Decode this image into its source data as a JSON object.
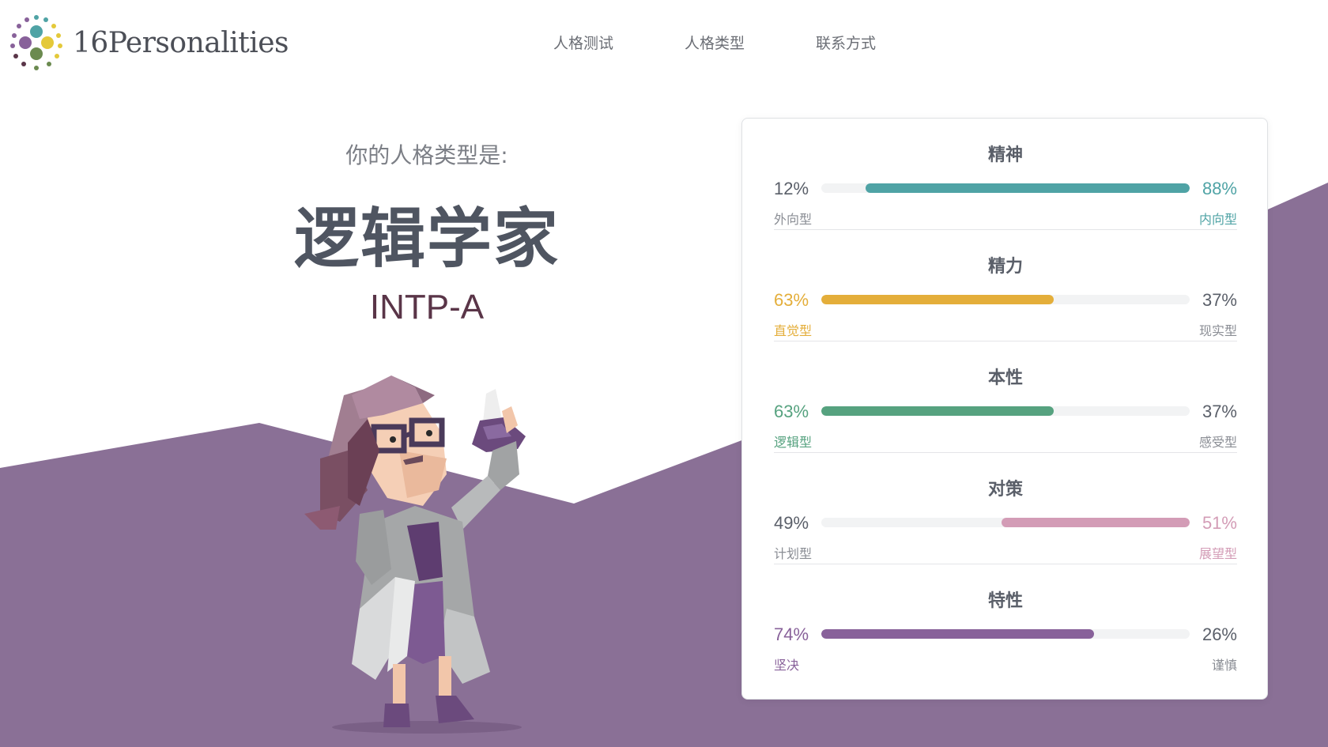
{
  "brand": {
    "name": "16Personalities"
  },
  "nav": {
    "items": [
      "人格测试",
      "人格类型",
      "联系方式"
    ]
  },
  "hero": {
    "intro": "你的人格类型是:",
    "type_name": "逻辑学家",
    "type_code": "INTP-A"
  },
  "colors": {
    "purple_bg": "#8a7096",
    "teal": "#4fa3a5",
    "yellow": "#e4ae3a",
    "green": "#56a27f",
    "pink": "#d39cb6",
    "violet": "#88619a"
  },
  "traits": [
    {
      "title": "精神",
      "left_pct": "12%",
      "right_pct": "88%",
      "left_label": "外向型",
      "right_label": "内向型",
      "dominant": "right",
      "fill": 0.88,
      "color": "#4fa3a5"
    },
    {
      "title": "精力",
      "left_pct": "63%",
      "right_pct": "37%",
      "left_label": "直觉型",
      "right_label": "现实型",
      "dominant": "left",
      "fill": 0.63,
      "color": "#e4ae3a"
    },
    {
      "title": "本性",
      "left_pct": "63%",
      "right_pct": "37%",
      "left_label": "逻辑型",
      "right_label": "感受型",
      "dominant": "left",
      "fill": 0.63,
      "color": "#56a27f"
    },
    {
      "title": "对策",
      "left_pct": "49%",
      "right_pct": "51%",
      "left_label": "计划型",
      "right_label": "展望型",
      "dominant": "right",
      "fill": 0.51,
      "color": "#d39cb6"
    },
    {
      "title": "特性",
      "left_pct": "74%",
      "right_pct": "26%",
      "left_label": "坚决",
      "right_label": "谨慎",
      "dominant": "left",
      "fill": 0.74,
      "color": "#88619a"
    }
  ]
}
